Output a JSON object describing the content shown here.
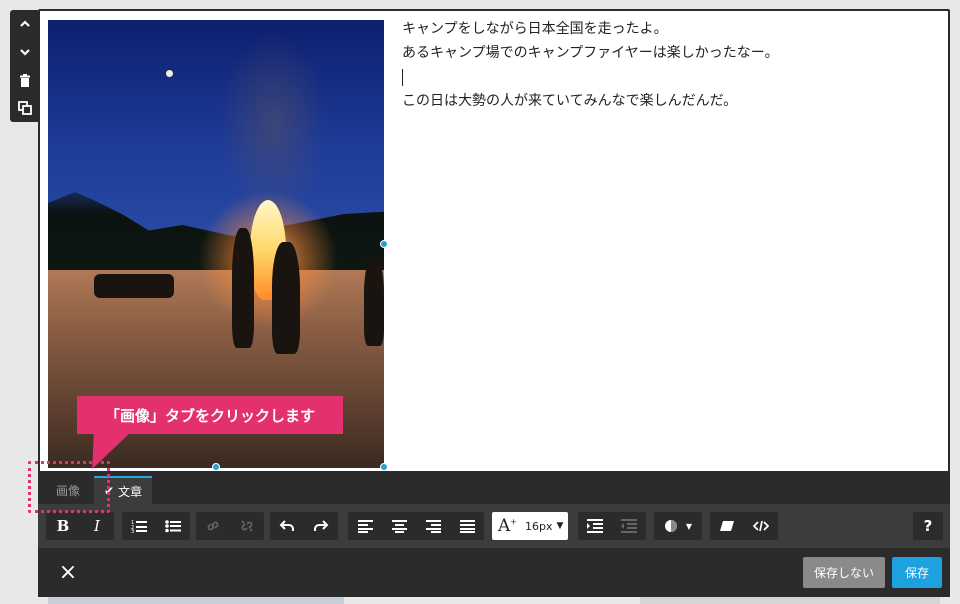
{
  "float_toolbar": {
    "items": [
      {
        "name": "move-up-icon",
        "glyph": "⌃"
      },
      {
        "name": "move-down-icon",
        "glyph": "⌄"
      },
      {
        "name": "trash-icon",
        "glyph": "🗑"
      },
      {
        "name": "copy-icon",
        "glyph": "❐"
      }
    ]
  },
  "content": {
    "lines": [
      "キャンプをしながら日本全国を走ったよ。",
      "あるキャンプ場でのキャンプファイヤーは楽しかったなー。",
      "",
      "この日は大勢の人が来ていてみんなで楽しんだんだ。"
    ]
  },
  "callout": {
    "text": "「画像」タブをクリックします",
    "color": "#e3306f"
  },
  "tabs": {
    "image_label": "画像",
    "text_label": "文章",
    "active": "文章"
  },
  "format_bar": {
    "bold": "B",
    "italic": "I",
    "font_size": "16px",
    "help": "?"
  },
  "footer": {
    "close": "×",
    "nosave_label": "保存しない",
    "save_label": "保存",
    "accent": "#1ea1df"
  }
}
